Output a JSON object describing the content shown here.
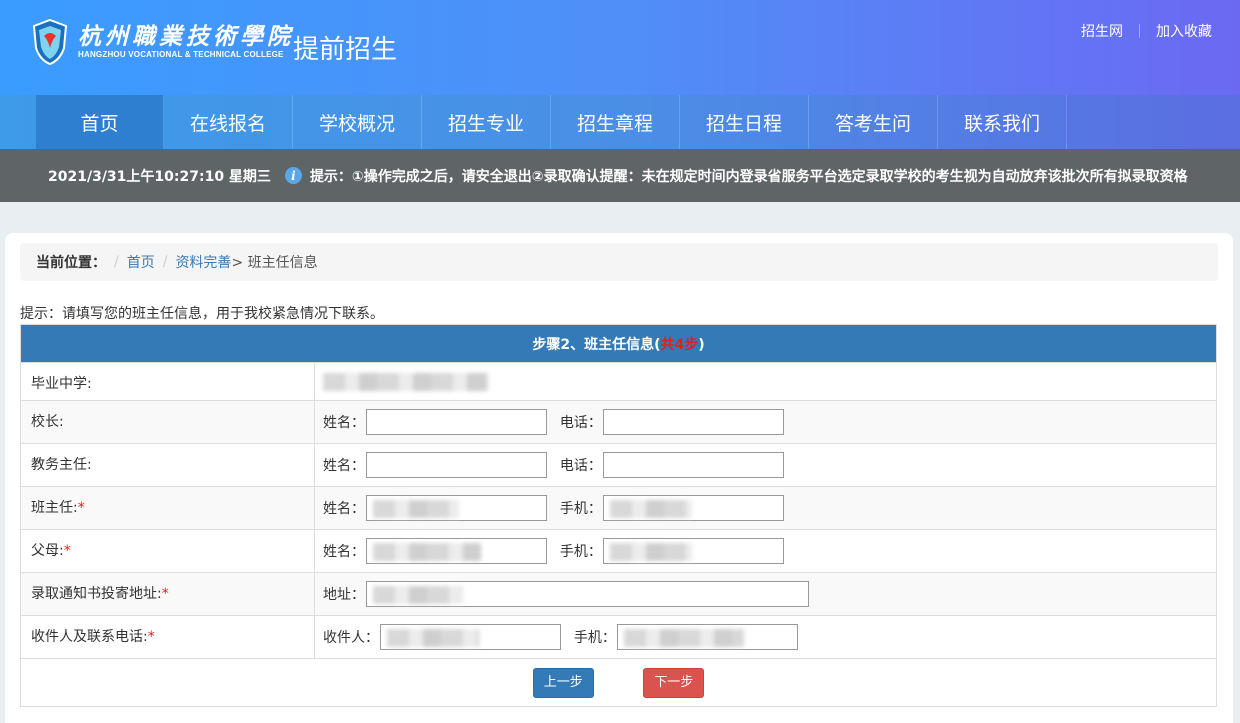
{
  "header": {
    "brand_cn": "杭州職業技術學院",
    "brand_en": "HANGZHOU VOCATIONAL & TECHNICAL COLLEGE",
    "site_title": "提前招生",
    "links": [
      "招生网",
      "加入收藏"
    ]
  },
  "nav": {
    "items": [
      "首页",
      "在线报名",
      "学校概况",
      "招生专业",
      "招生章程",
      "招生日程",
      "答考生问",
      "联系我们"
    ]
  },
  "notice": {
    "datetime": "2021/3/31上午10:27:10 星期三",
    "text": "提示：①操作完成之后，请安全退出②录取确认提醒：未在规定时间内登录省服务平台选定录取学校的考生视为自动放弃该批次所有拟录取资格"
  },
  "breadcrumb": {
    "label": "当前位置：",
    "home": "首页",
    "section": "资料完善",
    "current": "> 班主任信息"
  },
  "tip": "提示：请填写您的班主任信息，用于我校紧急情况下联系。",
  "form": {
    "title_main": "步骤2、班主任信息(",
    "title_red": "共4步",
    "title_end": ")",
    "rows": {
      "school": {
        "label": "毕业中学:"
      },
      "principal": {
        "label": "校长:",
        "name": "姓名：",
        "phone": "电话："
      },
      "dean": {
        "label": "教务主任:",
        "name": "姓名：",
        "phone": "电话："
      },
      "teacher": {
        "label": "班主任:",
        "req": "*",
        "name": "姓名：",
        "phone": "手机："
      },
      "parent": {
        "label": "父母:",
        "req": "*",
        "name": "姓名：",
        "phone": "手机："
      },
      "address": {
        "label": "录取通知书投寄地址:",
        "req": "*",
        "addr": "地址："
      },
      "receiver": {
        "label": "收件人及联系电话:",
        "req": "*",
        "name": "收件人：",
        "phone": "手机："
      }
    },
    "prev_button": "上一步",
    "next_button": "下一步"
  },
  "colors": {
    "primary": "#337ab7",
    "danger": "#d9534f",
    "required": "#e02020"
  }
}
